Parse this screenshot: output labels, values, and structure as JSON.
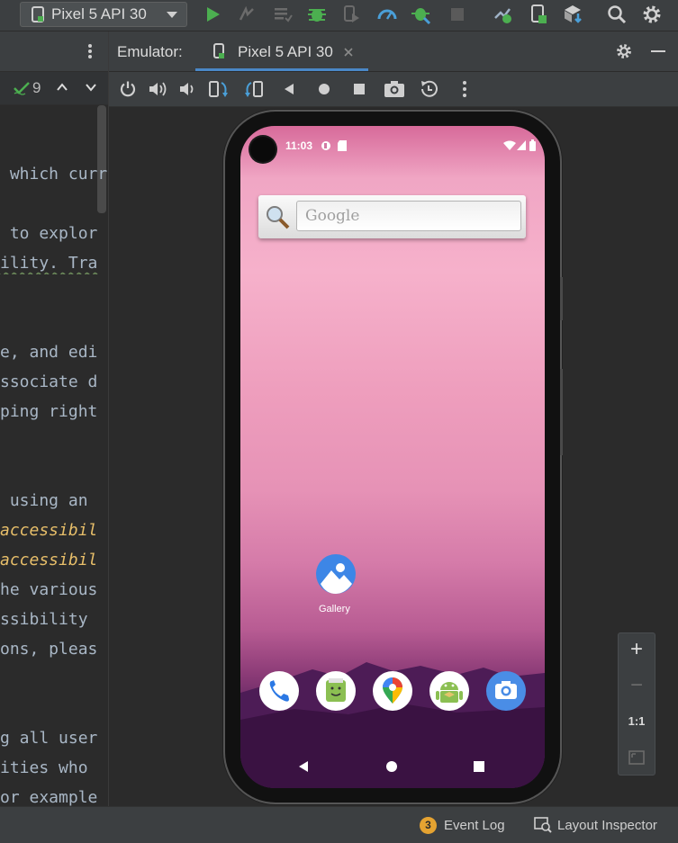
{
  "toolbar": {
    "device_selector": "Pixel 5 API 30",
    "icons": [
      "device-icon",
      "run-icon",
      "apply-changes-icon",
      "apply-code-icon",
      "debug-icon",
      "attach-debugger-icon",
      "profiler-icon",
      "debug-app-icon",
      "stop-icon",
      "sync-icon",
      "device-manager-icon",
      "sdk-manager-icon",
      "search-icon",
      "settings-icon"
    ]
  },
  "editor": {
    "match_count": "9",
    "lines": [
      {
        "text": " which curr"
      },
      {
        "text": " to explor"
      },
      {
        "text": "ility. Tra"
      },
      {
        "text": "e, and edi"
      },
      {
        "text": "ssociate d"
      },
      {
        "text": "ping right"
      },
      {
        "text": " using an"
      },
      {
        "text": "accessibil",
        "emphasis": true
      },
      {
        "text": "accessibil",
        "emphasis": true
      },
      {
        "text": "he various"
      },
      {
        "text": "ssibility"
      },
      {
        "text": "ons, pleas"
      },
      {
        "text": "g all user"
      },
      {
        "text": "ities who"
      },
      {
        "text": "or example"
      }
    ]
  },
  "emulator": {
    "label": "Emulator:",
    "tab_title": "Pixel 5 API 30",
    "controls": [
      "power-icon",
      "volume-up-icon",
      "volume-down-icon",
      "rotate-left-icon",
      "rotate-right-icon",
      "back-icon",
      "home-icon",
      "overview-icon",
      "screenshot-icon",
      "snapshot-icon",
      "more-icon"
    ]
  },
  "phone": {
    "time": "11:03",
    "search_placeholder": "Google",
    "gallery_label": "Gallery",
    "dock": [
      "phone-app-icon",
      "messages-app-icon",
      "maps-app-icon",
      "android-app-icon",
      "camera-app-icon"
    ]
  },
  "zoom": {
    "plus": "+",
    "minus": "−",
    "one_to_one": "1:1"
  },
  "statusbar": {
    "event_count": "3",
    "event_log": "Event Log",
    "layout_inspector": "Layout Inspector"
  },
  "colors": {
    "ide_bg": "#2b2b2b",
    "panel_bg": "#3c3f41",
    "run_green": "#4caf50",
    "accent_blue": "#4a9fd8",
    "badge_orange": "#e5a331"
  }
}
